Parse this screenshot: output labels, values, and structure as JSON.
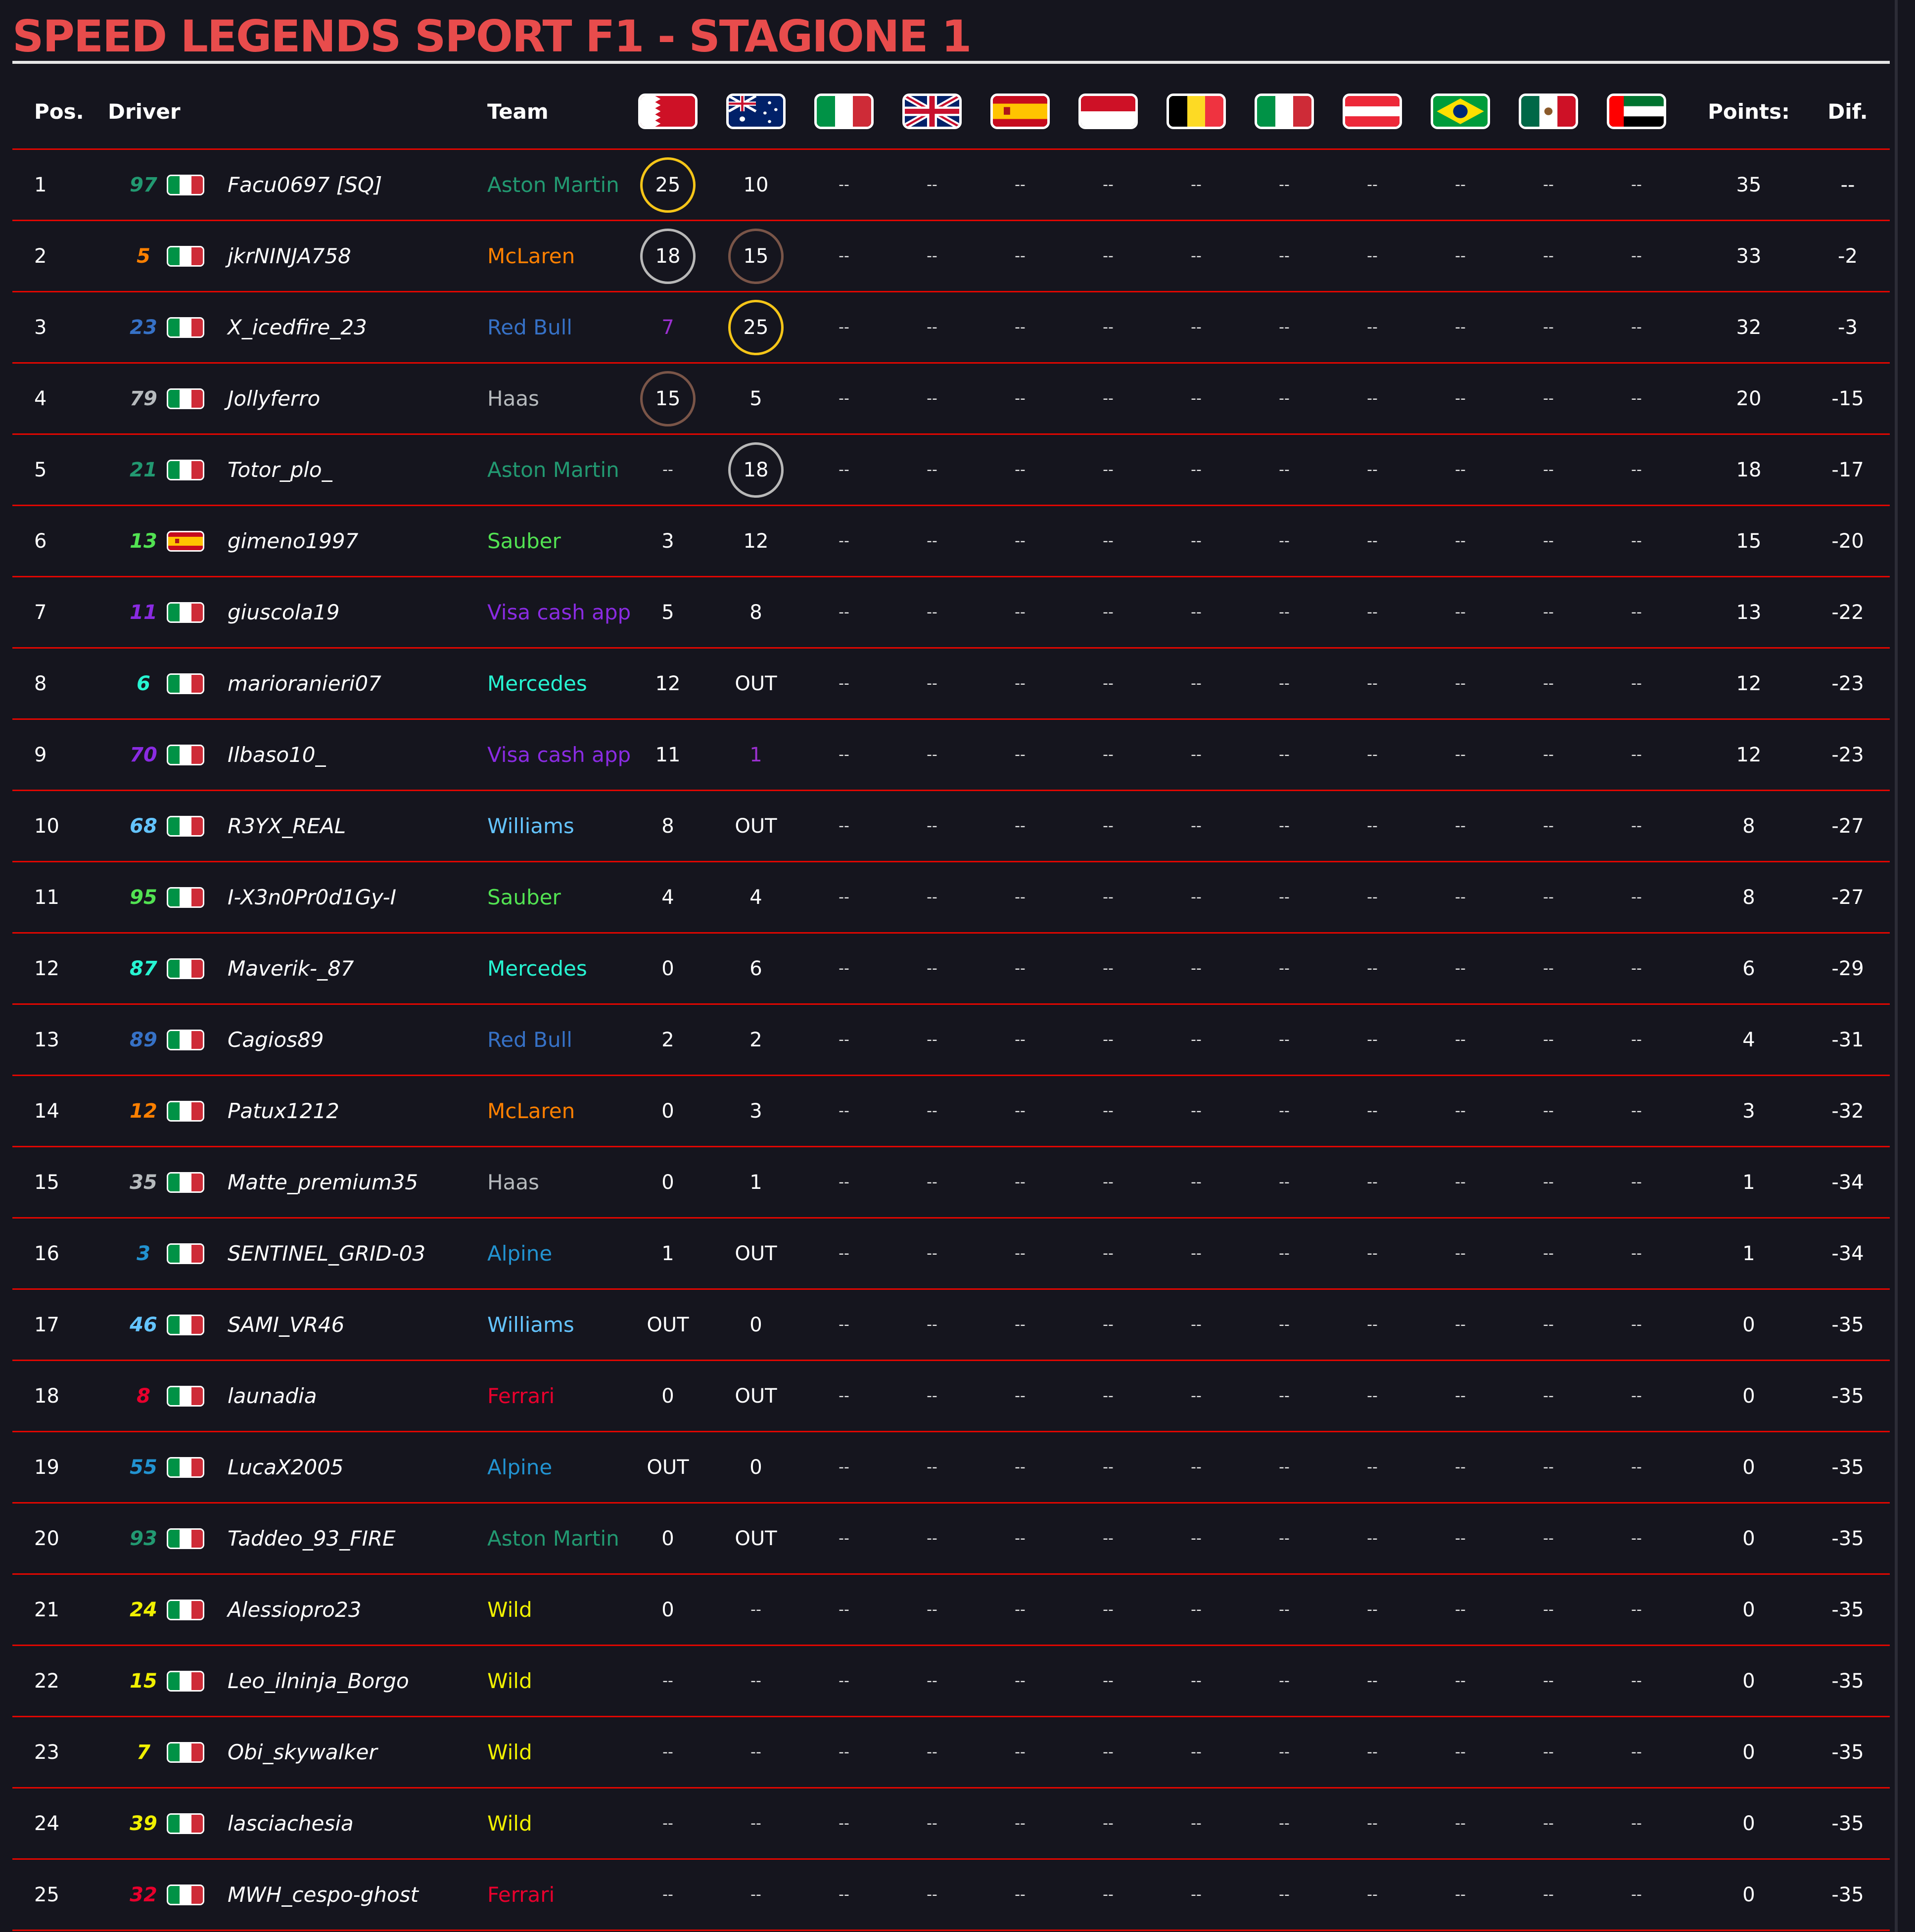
{
  "title": "SPEED LEGENDS SPORT F1 - STAGIONE 1",
  "headers": {
    "pos": "Pos.",
    "driver": "Driver",
    "team": "Team",
    "points": "Points:",
    "dif": "Dif."
  },
  "races": [
    {
      "flag": "bahrain-flag-icon"
    },
    {
      "flag": "australia-flag-icon"
    },
    {
      "flag": "italy-flag-icon"
    },
    {
      "flag": "united-kingdom-flag-icon"
    },
    {
      "flag": "spain-flag-icon"
    },
    {
      "flag": "monaco-flag-icon"
    },
    {
      "flag": "belgium-flag-icon"
    },
    {
      "flag": "italy-flag-icon"
    },
    {
      "flag": "austria-flag-icon"
    },
    {
      "flag": "brazil-flag-icon"
    },
    {
      "flag": "mexico-flag-icon"
    },
    {
      "flag": "uae-flag-icon"
    }
  ],
  "colors": {
    "title": "#e84c4c",
    "row_divider": "#e10600",
    "podium_gold": "#f5c518",
    "podium_silver": "#b8b8b8",
    "podium_bronze": "#7a5548",
    "aston_martin": "#229971",
    "mclaren": "#ff8000",
    "red_bull": "#3671c6",
    "haas": "#b6babd",
    "sauber": "#52e252",
    "visa_cash_app": "#8a2be2",
    "mercedes": "#27f4d2",
    "williams": "#64c4ff",
    "alpine": "#2293d1",
    "ferrari": "#e8002d",
    "wild": "#f0f000"
  },
  "rows": [
    {
      "pos": "1",
      "num": "97",
      "flag": "italy",
      "name": "Facu0697 [SQ]",
      "team": "Aston Martin",
      "team_color": "#229971",
      "r1": "25",
      "r1_ring": "gold",
      "r2": "10",
      "points": "35",
      "dif": "--"
    },
    {
      "pos": "2",
      "num": "5",
      "flag": "italy",
      "name": "jkrNINJA758",
      "team": "McLaren",
      "team_color": "#ff8000",
      "r1": "18",
      "r1_ring": "silver",
      "r2": "15",
      "r2_ring": "bronze",
      "points": "33",
      "dif": "-2"
    },
    {
      "pos": "3",
      "num": "23",
      "flag": "italy",
      "name": "X_icedfire_23",
      "team": "Red Bull",
      "team_color": "#3671c6",
      "r1": "7",
      "r1_color": "#9b30d0",
      "r2": "25",
      "r2_ring": "gold",
      "points": "32",
      "dif": "-3"
    },
    {
      "pos": "4",
      "num": "79",
      "flag": "italy",
      "name": "Jollyferro",
      "team": "Haas",
      "team_color": "#b6babd",
      "r1": "15",
      "r1_ring": "bronze",
      "r2": "5",
      "points": "20",
      "dif": "-15"
    },
    {
      "pos": "5",
      "num": "21",
      "flag": "italy",
      "name": "Totor_plo_",
      "team": "Aston Martin",
      "team_color": "#229971",
      "r1": "--",
      "r2": "18",
      "r2_ring": "silver",
      "points": "18",
      "dif": "-17"
    },
    {
      "pos": "6",
      "num": "13",
      "flag": "spain",
      "name": "gimeno1997",
      "team": "Sauber",
      "team_color": "#52e252",
      "r1": "3",
      "r2": "12",
      "points": "15",
      "dif": "-20"
    },
    {
      "pos": "7",
      "num": "11",
      "flag": "italy",
      "name": "giuscola19",
      "team": "Visa cash app",
      "team_color": "#8a2be2",
      "r1": "5",
      "r2": "8",
      "points": "13",
      "dif": "-22"
    },
    {
      "pos": "8",
      "num": "6",
      "flag": "italy",
      "name": "marioranieri07",
      "team": "Mercedes",
      "team_color": "#27f4d2",
      "r1": "12",
      "r2": "OUT",
      "points": "12",
      "dif": "-23"
    },
    {
      "pos": "9",
      "num": "70",
      "flag": "italy",
      "name": "Ilbaso10_",
      "team": "Visa cash app",
      "team_color": "#8a2be2",
      "r1": "11",
      "r2": "1",
      "r2_color": "#9b30d0",
      "points": "12",
      "dif": "-23"
    },
    {
      "pos": "10",
      "num": "68",
      "flag": "italy",
      "name": "R3YX_REAL",
      "team": "Williams",
      "team_color": "#64c4ff",
      "r1": "8",
      "r2": "OUT",
      "points": "8",
      "dif": "-27"
    },
    {
      "pos": "11",
      "num": "95",
      "flag": "italy",
      "name": "I-X3n0Pr0d1Gy-I",
      "team": "Sauber",
      "team_color": "#52e252",
      "r1": "4",
      "r2": "4",
      "points": "8",
      "dif": "-27"
    },
    {
      "pos": "12",
      "num": "87",
      "flag": "italy",
      "name": "Maverik-_87",
      "team": "Mercedes",
      "team_color": "#27f4d2",
      "r1": "0",
      "r2": "6",
      "points": "6",
      "dif": "-29"
    },
    {
      "pos": "13",
      "num": "89",
      "flag": "italy",
      "name": "Cagios89",
      "team": "Red Bull",
      "team_color": "#3671c6",
      "r1": "2",
      "r2": "2",
      "points": "4",
      "dif": "-31"
    },
    {
      "pos": "14",
      "num": "12",
      "flag": "italy",
      "name": "Patux1212",
      "team": "McLaren",
      "team_color": "#ff8000",
      "r1": "0",
      "r2": "3",
      "points": "3",
      "dif": "-32"
    },
    {
      "pos": "15",
      "num": "35",
      "flag": "italy",
      "name": "Matte_premium35",
      "team": "Haas",
      "team_color": "#b6babd",
      "r1": "0",
      "r2": "1",
      "points": "1",
      "dif": "-34"
    },
    {
      "pos": "16",
      "num": "3",
      "flag": "italy",
      "name": "SENTINEL_GRID-03",
      "team": "Alpine",
      "team_color": "#2293d1",
      "r1": "1",
      "r2": "OUT",
      "points": "1",
      "dif": "-34"
    },
    {
      "pos": "17",
      "num": "46",
      "flag": "italy",
      "name": "SAMI_VR46",
      "team": "Williams",
      "team_color": "#64c4ff",
      "r1": "OUT",
      "r2": "0",
      "points": "0",
      "dif": "-35"
    },
    {
      "pos": "18",
      "num": "8",
      "flag": "italy",
      "name": "launadia",
      "team": "Ferrari",
      "team_color": "#e8002d",
      "r1": "0",
      "r2": "OUT",
      "points": "0",
      "dif": "-35"
    },
    {
      "pos": "19",
      "num": "55",
      "flag": "italy",
      "name": "LucaX2005",
      "team": "Alpine",
      "team_color": "#2293d1",
      "r1": "OUT",
      "r2": "0",
      "points": "0",
      "dif": "-35"
    },
    {
      "pos": "20",
      "num": "93",
      "flag": "italy",
      "name": "Taddeo_93_FIRE",
      "team": "Aston Martin",
      "team_color": "#229971",
      "r1": "0",
      "r2": "OUT",
      "points": "0",
      "dif": "-35"
    },
    {
      "pos": "21",
      "num": "24",
      "flag": "italy",
      "name": "Alessiopro23",
      "team": "Wild",
      "team_color": "#f0f000",
      "r1": "0",
      "r2": "--",
      "points": "0",
      "dif": "-35"
    },
    {
      "pos": "22",
      "num": "15",
      "flag": "italy",
      "name": "Leo_ilninja_Borgo",
      "team": "Wild",
      "team_color": "#f0f000",
      "r1": "--",
      "r2": "--",
      "points": "0",
      "dif": "-35"
    },
    {
      "pos": "23",
      "num": "7",
      "flag": "italy",
      "name": "Obi_skywalker",
      "team": "Wild",
      "team_color": "#f0f000",
      "r1": "--",
      "r2": "--",
      "points": "0",
      "dif": "-35"
    },
    {
      "pos": "24",
      "num": "39",
      "flag": "italy",
      "name": "lasciachesia",
      "team": "Wild",
      "team_color": "#f0f000",
      "r1": "--",
      "r2": "--",
      "points": "0",
      "dif": "-35"
    },
    {
      "pos": "25",
      "num": "32",
      "flag": "italy",
      "name": "MWH_cespo-ghost",
      "team": "Ferrari",
      "team_color": "#e8002d",
      "r1": "--",
      "r2": "--",
      "points": "0",
      "dif": "-35"
    }
  ],
  "empty_result": "--"
}
